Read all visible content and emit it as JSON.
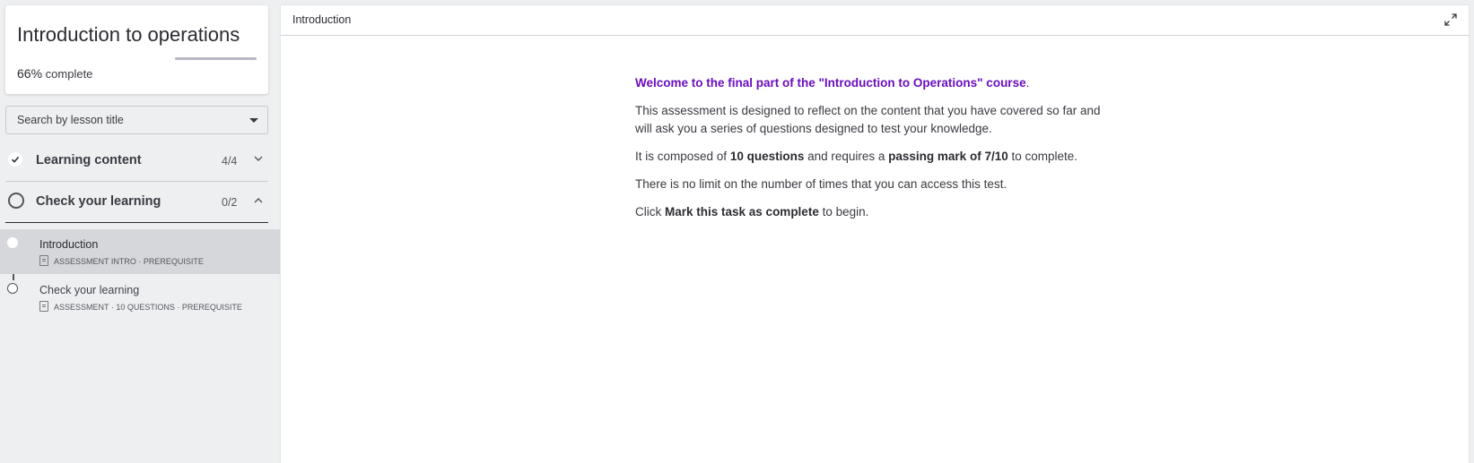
{
  "course": {
    "title": "Introduction to operations",
    "progress_percent": "66%",
    "progress_suffix": "complete",
    "progress_fill_fraction": 0.0
  },
  "search": {
    "label": "Search by lesson title"
  },
  "sections": [
    {
      "title": "Learning content",
      "count": "4/4",
      "status": "complete",
      "expanded": false
    },
    {
      "title": "Check your learning",
      "count": "0/2",
      "status": "incomplete",
      "expanded": true
    }
  ],
  "lessons": [
    {
      "title": "Introduction",
      "meta": "ASSESSMENT INTRO · PREREQUISITE",
      "active": true
    },
    {
      "title": "Check your learning",
      "meta": "ASSESSMENT · 10 QUESTIONS · PREREQUISITE",
      "active": false
    }
  ],
  "main": {
    "header_title": "Introduction",
    "welcome": "Welcome to the final part of the \"Introduction to Operations\" course",
    "welcome_end": ".",
    "p1": "This assessment is designed to reflect on the content that you have covered so far and will ask you a series of questions designed to test your knowledge.",
    "p2_a": "It is composed of ",
    "p2_b": "10 questions",
    "p2_c": " and requires a ",
    "p2_d": "passing mark of 7/10",
    "p2_e": " to complete.",
    "p3": "There is no limit on the number of times that you can access this test.",
    "p4_a": "Click ",
    "p4_b": "Mark this task as complete",
    "p4_c": " to begin."
  },
  "icons": {
    "section1_status": "check-icon",
    "section1_chevron": "chevron-down-icon",
    "section2_chevron": "chevron-up-icon",
    "search_caret": "caret-down-icon",
    "expand": "expand-icon",
    "lesson_doc": "document-icon"
  },
  "colors": {
    "accent": "#6a0dbf",
    "sidebar_bg": "#eeeff1",
    "active_lesson_bg": "#d6d7db"
  }
}
